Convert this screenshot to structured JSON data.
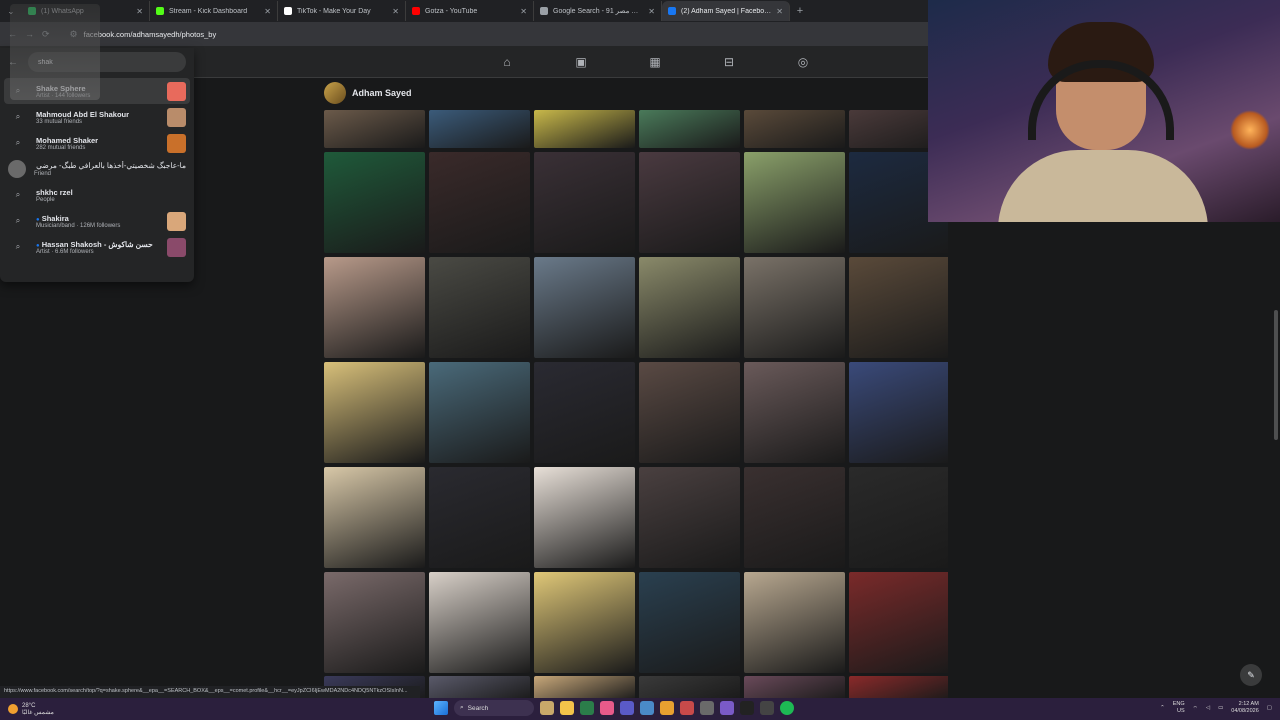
{
  "tabs": [
    {
      "title": "(1) WhatsApp",
      "color": "#25d366"
    },
    {
      "title": "Stream - Kick Dashboard",
      "color": "#53fc18"
    },
    {
      "title": "TikTok - Make Your Day",
      "color": "#ffffff"
    },
    {
      "title": "Gotza - YouTube",
      "color": "#ff0000"
    },
    {
      "title": "Google Search - رابل مصر 91",
      "color": "#9aa0a6"
    },
    {
      "title": "(2) Adham Sayed | Facebook",
      "color": "#1877f2",
      "active": true
    }
  ],
  "address": {
    "url": "facebook.com/adhamsayedh/photos_by"
  },
  "search": {
    "query": "shak",
    "results": [
      {
        "name": "Shake Sphere",
        "sub": "Artist · 144 followers",
        "icon": "search-icon",
        "thumb": "#e86a5c"
      },
      {
        "name": "Mahmoud Abd El Shakour",
        "sub": "33 mutual friends",
        "icon": "search-icon",
        "thumb": "#b98c6a"
      },
      {
        "name": "Mohamed Shaker",
        "sub": "282 mutual friends",
        "icon": "search-icon",
        "thumb": "#c9702a"
      },
      {
        "name": "ما-عاجبگ شخصيتي-أخذها بالعرافي طبگ- مرضي",
        "sub": "Friend",
        "icon": "avatar",
        "thumb": ""
      },
      {
        "name": "shkhc rzel",
        "sub": "People",
        "icon": "search-icon",
        "thumb": ""
      },
      {
        "name": "Shakira",
        "sub": "Musician/band · 126M followers",
        "icon": "search-icon",
        "thumb": "#d9a77a",
        "verified": true
      },
      {
        "name": "Hassan Shakosh - حسن شاكوش",
        "sub": "Artist · 6.6M followers",
        "icon": "search-icon",
        "thumb": "#8a4a6a",
        "verified": true
      }
    ]
  },
  "profile": {
    "name": "Adham Sayed"
  },
  "status_url": "https://www.facebook.com/search/top/?q=shake.sphere&__epa__=SEARCH_BOX&__eps__=comet.profile&__hcr__=eyJpZCI6IjEwMDA2NDc4NDQ5NTkzOSIsInN...",
  "taskbar": {
    "temp": "28°C",
    "weather_desc": "مشمس غالبًا",
    "search_label": "Search",
    "lang": "ENG",
    "region": "US",
    "time": "2:12 AM",
    "date": "04/08/2026"
  },
  "photos_top": [
    "#6b5a4a",
    "#3b5b7a",
    "#c8b84a",
    "#4a7a5a",
    "#5a4a3a",
    "#4a3a3a"
  ],
  "photos": [
    "#1f5a3a",
    "#3a2a2a",
    "#3a3036",
    "#4a3a40",
    "#8aa06a",
    "#1c2a40",
    "#b89a8a",
    "#4a4a44",
    "#6a7a8a",
    "#8a8a6a",
    "#7a7268",
    "#5a4a3a",
    "#d8c07a",
    "#4a6a7a",
    "#2a2a32",
    "#5a4a44",
    "#6a5a5a",
    "#3a4a7a",
    "#d8c8a8",
    "#2a2a30",
    "#e8e0d8",
    "#4a4040",
    "#3a3030",
    "#2a2a2a",
    "#7a6a6a",
    "#d8d0c8",
    "#e0c878",
    "#2a4050",
    "#b8a890",
    "#7a2a2a"
  ],
  "photos_bottom": [
    "#3a3a5a",
    "#5a5a6a",
    "#c8a87a",
    "#3a3a3a",
    "#6a4a5a",
    "#8a2a2a"
  ]
}
